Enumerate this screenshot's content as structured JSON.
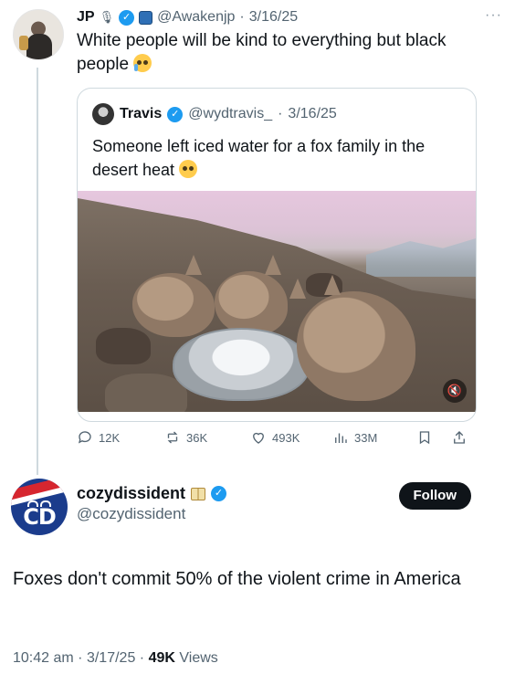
{
  "reply_tweet": {
    "author_name": "JP",
    "name_glyph": "🎙",
    "handle": "@Awakenjp",
    "date": "3/16/25",
    "text": "White people will be kind to everything but black people",
    "emoji": "loudly-crying-face",
    "more_icon": "more-dots-icon"
  },
  "quoted_tweet": {
    "author_name": "Travis",
    "handle": "@wydtravis_",
    "date": "3/16/25",
    "text": "Someone left iced water for a fox family in the desert heat",
    "emoji": "pleading-face",
    "media": "video: foxes drinking from a bowl of ice water",
    "mute_icon": "speaker-muted-icon"
  },
  "actions": {
    "replies": "12K",
    "reposts": "36K",
    "likes": "493K",
    "views": "33M"
  },
  "main_tweet": {
    "author_name": "cozydissident",
    "handle": "@cozydissident",
    "avatar_text": "CD",
    "follow_label": "Follow",
    "text": "Foxes don't commit 50% of the violent crime in America",
    "time": "10:42 am",
    "date": "3/17/25",
    "views_count": "49K",
    "views_label": "Views"
  },
  "colors": {
    "text": "#0f1419",
    "muted": "#536471",
    "verified": "#1d9bf0",
    "border": "#cfd9de"
  }
}
